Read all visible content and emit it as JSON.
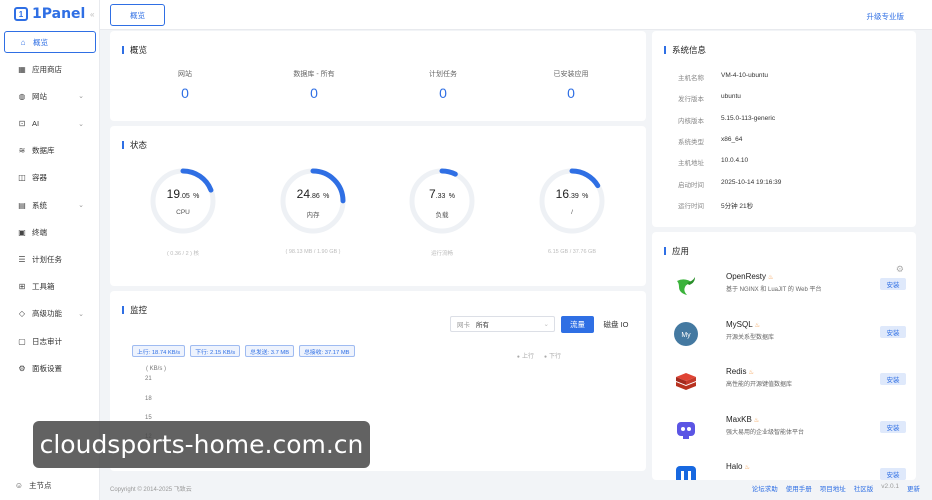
{
  "brand": {
    "name": "1Panel",
    "mark": "1"
  },
  "sidebar": {
    "items": [
      {
        "label": "概览",
        "icon": "home-icon",
        "glyph": "⌂",
        "active": true,
        "chevron": false
      },
      {
        "label": "应用商店",
        "icon": "grid-icon",
        "glyph": "▦",
        "chevron": false
      },
      {
        "label": "网站",
        "icon": "globe-icon",
        "glyph": "◍",
        "chevron": true
      },
      {
        "label": "AI",
        "icon": "robot-icon",
        "glyph": "⊡",
        "chevron": true
      },
      {
        "label": "数据库",
        "icon": "database-icon",
        "glyph": "≋",
        "chevron": false
      },
      {
        "label": "容器",
        "icon": "container-icon",
        "glyph": "◫",
        "chevron": false
      },
      {
        "label": "系统",
        "icon": "system-icon",
        "glyph": "▤",
        "chevron": true
      },
      {
        "label": "终端",
        "icon": "terminal-icon",
        "glyph": "▣",
        "chevron": false
      },
      {
        "label": "计划任务",
        "icon": "task-icon",
        "glyph": "☰",
        "chevron": false
      },
      {
        "label": "工具箱",
        "icon": "toolbox-icon",
        "glyph": "⊞",
        "chevron": false
      },
      {
        "label": "高级功能",
        "icon": "diamond-icon",
        "glyph": "◇",
        "chevron": true
      },
      {
        "label": "日志审计",
        "icon": "log-icon",
        "glyph": "▢",
        "chevron": false
      },
      {
        "label": "面板设置",
        "icon": "settings-icon",
        "glyph": "⚙",
        "chevron": false
      }
    ],
    "node": {
      "label": "主节点",
      "icon": "user-icon",
      "glyph": "☺"
    }
  },
  "topbar": {
    "tab": "概览",
    "upgrade": "升级专业版"
  },
  "overview": {
    "title": "概览",
    "stats": [
      {
        "label": "网站",
        "value": "0"
      },
      {
        "label": "数据库 - 所有",
        "value": "0"
      },
      {
        "label": "计划任务",
        "value": "0"
      },
      {
        "label": "已安装应用",
        "value": "0"
      }
    ]
  },
  "status": {
    "title": "状态",
    "gauges": [
      {
        "int": "19",
        "dec": ".05",
        "unit": "%",
        "label": "CPU",
        "percent": 19.05,
        "sub": "( 0.36 / 2 ) 核"
      },
      {
        "int": "24",
        "dec": ".86",
        "unit": "%",
        "label": "内存",
        "percent": 24.86,
        "sub": "( 98.13 MB / 1.90 GB )"
      },
      {
        "int": "7",
        "dec": ".33",
        "unit": "%",
        "label": "负载",
        "percent": 7.33,
        "sub": "运行流畅"
      },
      {
        "int": "16",
        "dec": ".39",
        "unit": "%",
        "label": "/",
        "percent": 16.39,
        "sub": "6.15 GB / 37.76 GB"
      }
    ]
  },
  "monitor": {
    "title": "监控",
    "nic_label": "网卡",
    "nic_value": "所有",
    "btn_traffic": "流量",
    "btn_disk": "磁盘 IO",
    "badges": [
      "上行: 18.74 KB/s",
      "下行: 2.15 KB/s",
      "总发送: 3.7 MB",
      "总接收: 37.17 MB"
    ],
    "legend": [
      "上行",
      "下行"
    ],
    "y_unit": "( KB/s )",
    "y_ticks": [
      "21",
      "18",
      "15",
      "12"
    ]
  },
  "sysinfo": {
    "title": "系统信息",
    "rows": [
      {
        "key": "主机名称",
        "val": "VM-4-10-ubuntu"
      },
      {
        "key": "发行版本",
        "val": "ubuntu"
      },
      {
        "key": "内核版本",
        "val": "5.15.0-113-generic"
      },
      {
        "key": "系统类型",
        "val": "x86_64"
      },
      {
        "key": "主机地址",
        "val": "10.0.4.10"
      },
      {
        "key": "启动时间",
        "val": "2025-10-14 19:16:39"
      },
      {
        "key": "运行时间",
        "val": "5分钟 21秒"
      }
    ]
  },
  "apps": {
    "title": "应用",
    "install_label": "安装",
    "items": [
      {
        "name": "OpenResty",
        "desc": "基于 NGINX 和 LuaJIT 的 Web 平台",
        "icon": "openresty-icon"
      },
      {
        "name": "MySQL",
        "desc": "开源关系型数据库",
        "icon": "mysql-icon"
      },
      {
        "name": "Redis",
        "desc": "高性能的开源键值数据库",
        "icon": "redis-icon"
      },
      {
        "name": "MaxKB",
        "desc": "强大易用的企业级智能体平台",
        "icon": "maxkb-icon"
      },
      {
        "name": "Halo",
        "desc": "",
        "icon": "halo-icon"
      }
    ]
  },
  "footer": {
    "copyright": "Copyright © 2014-2025 飞致云",
    "links": [
      "论坛求助",
      "使用手册",
      "项目地址",
      "社区版"
    ],
    "version": "v2.0.1",
    "update": "更新"
  },
  "watermark": "cloudsports-home.com.cn",
  "colors": {
    "accent": "#2f6fe4",
    "background": "#f2f4f7",
    "flame": "#f08a2c"
  }
}
